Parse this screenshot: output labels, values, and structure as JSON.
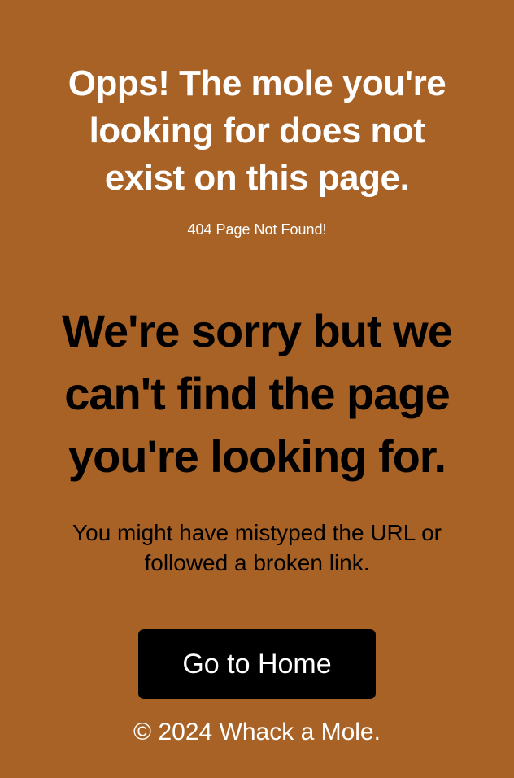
{
  "colors": {
    "background": "#A96226",
    "headline": "#FFFFFF",
    "body_text": "#000000",
    "button_bg": "#000000",
    "button_text": "#FFFFFF"
  },
  "error": {
    "headline_lines": [
      "Opps! The mole you're",
      "looking for does not",
      "exist on this page."
    ],
    "code_text": "404 Page Not Found!"
  },
  "message": {
    "title_lines": [
      "We're sorry but we",
      "can't find the page",
      "you're looking for."
    ],
    "hint_lines": [
      "You might have mistyped the URL or",
      "followed a broken link."
    ]
  },
  "actions": {
    "home_label": "Go to Home"
  },
  "footer": {
    "copyright": "© 2024 Whack a Mole."
  }
}
